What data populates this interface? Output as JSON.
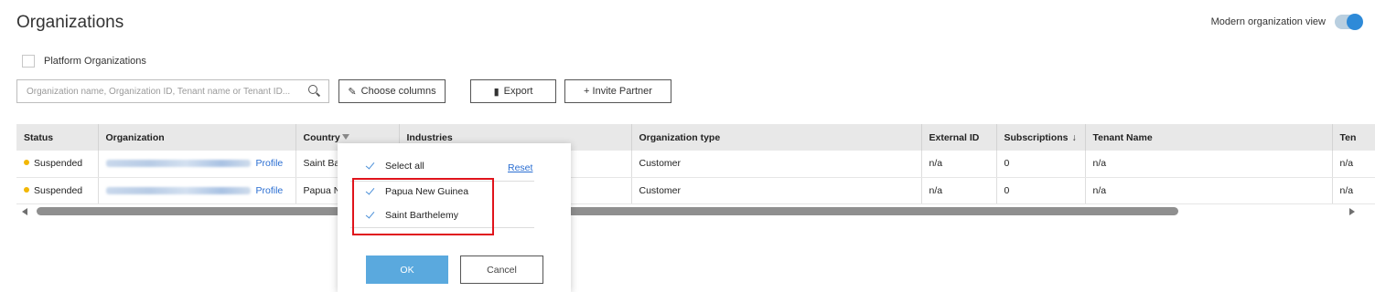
{
  "page": {
    "title": "Organizations",
    "modern_view_label": "Modern organization view",
    "modern_view_on": true
  },
  "filters": {
    "platform_organizations_label": "Platform Organizations",
    "platform_organizations_checked": false
  },
  "toolbar": {
    "search_placeholder": "Organization name, Organization ID, Tenant name or Tenant ID...",
    "choose_columns_label": "Choose columns",
    "export_label": "Export",
    "invite_partner_label": "+ Invite Partner"
  },
  "table": {
    "headers": {
      "status": "Status",
      "organization": "Organization",
      "country": "Country",
      "industries": "Industries",
      "organization_type": "Organization type",
      "external_id": "External ID",
      "subscriptions": "Subscriptions",
      "subscriptions_sort": "↓",
      "tenant_name": "Tenant Name",
      "tenant_extra": "Ten"
    },
    "rows": [
      {
        "status": "Suspended",
        "organization_link": "Profile",
        "country": "Saint Ba",
        "industries": "",
        "organization_type": "Customer",
        "external_id": "n/a",
        "subscriptions": "0",
        "tenant_name": "n/a",
        "tenant_extra": "n/a"
      },
      {
        "status": "Suspended",
        "organization_link": "Profile",
        "country": "Papua N",
        "industries": "",
        "organization_type": "Customer",
        "external_id": "n/a",
        "subscriptions": "0",
        "tenant_name": "n/a",
        "tenant_extra": "n/a"
      }
    ]
  },
  "country_filter_popup": {
    "select_all_label": "Select all",
    "reset_label": "Reset",
    "options": [
      {
        "label": "Papua New Guinea",
        "checked": true
      },
      {
        "label": "Saint Barthelemy",
        "checked": true
      }
    ],
    "ok_label": "OK",
    "cancel_label": "Cancel"
  },
  "colors": {
    "accent": "#2e8ad8",
    "link": "#2a6ed2",
    "status_suspended": "#f2b705",
    "highlight_box": "#e0141c",
    "ok_button": "#5aa9de"
  }
}
